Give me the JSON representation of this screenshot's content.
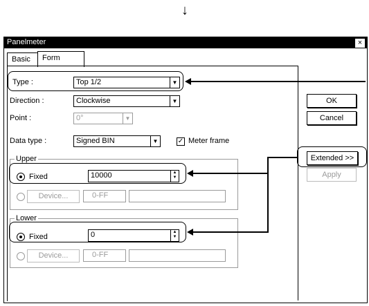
{
  "flow_arrow": "↓",
  "window": {
    "title": "Panelmeter",
    "close_glyph": "×"
  },
  "tabs": [
    {
      "label": "Basic"
    },
    {
      "label": "Form"
    }
  ],
  "form": {
    "type_label": "Type :",
    "type_value": "Top 1/2",
    "direction_label": "Direction :",
    "direction_value": "Clockwise",
    "point_label": "Point :",
    "point_value": "0°",
    "data_type_label": "Data type :",
    "data_type_value": "Signed BIN",
    "meter_frame_label": "Meter frame",
    "meter_frame_checked": "✓"
  },
  "upper": {
    "group_label": "Upper",
    "fixed_label": "Fixed",
    "fixed_value": "10000",
    "device_label": "Device...",
    "device_range": "0-FF",
    "device_value": ""
  },
  "lower": {
    "group_label": "Lower",
    "fixed_label": "Fixed",
    "fixed_value": "0",
    "device_label": "Device...",
    "device_range": "0-FF",
    "device_value": ""
  },
  "buttons": {
    "ok": "OK",
    "cancel": "Cancel",
    "extended": "Extended >>",
    "apply": "Apply"
  }
}
